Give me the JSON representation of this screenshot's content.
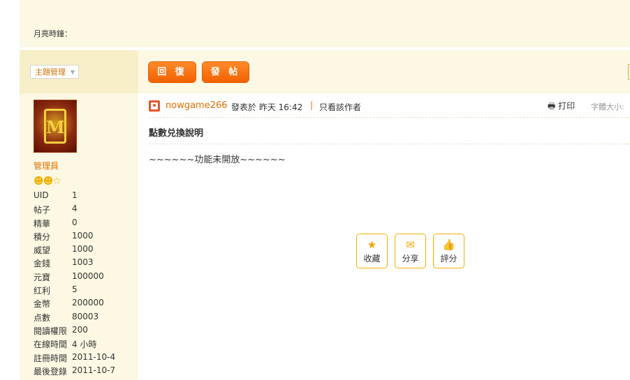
{
  "header": {
    "moon_clock_label": "月亮時鐘："
  },
  "toolbar": {
    "manage_label": "主題管理",
    "reply_label": "回 復",
    "post_label": "發 帖"
  },
  "user": {
    "role": "管理員",
    "stats": [
      {
        "k": "UID",
        "v": "1"
      },
      {
        "k": "帖子",
        "v": "4"
      },
      {
        "k": "精華",
        "v": "0"
      },
      {
        "k": "積分",
        "v": "1000"
      },
      {
        "k": "威望",
        "v": "1000"
      },
      {
        "k": "金錢",
        "v": "1003"
      },
      {
        "k": "元寶",
        "v": "100000"
      },
      {
        "k": "红利",
        "v": "5"
      },
      {
        "k": "金幣",
        "v": "200000"
      },
      {
        "k": "点數",
        "v": "80003"
      },
      {
        "k": "閱讀權限",
        "v": "200"
      },
      {
        "k": "在線時間",
        "v": "4 小時"
      },
      {
        "k": "註冊時間",
        "v": "2011-10-4"
      },
      {
        "k": "最後登錄",
        "v": "2011-10-7"
      }
    ]
  },
  "post": {
    "author": "nowgame266",
    "posted": "發表於 昨天 16:42",
    "separator": "|",
    "only_author": "只看該作者",
    "print": "打印",
    "font_size": "字體大小:",
    "title": "點數兑換說明",
    "body": "~~~~~~功能未開放~~~~~~"
  },
  "actions": {
    "favorite": "收藏",
    "share": "分享",
    "rate": "評分"
  },
  "colors": {
    "accent": "#e07000",
    "panel": "#fcf8e3",
    "button": "#f26100"
  }
}
